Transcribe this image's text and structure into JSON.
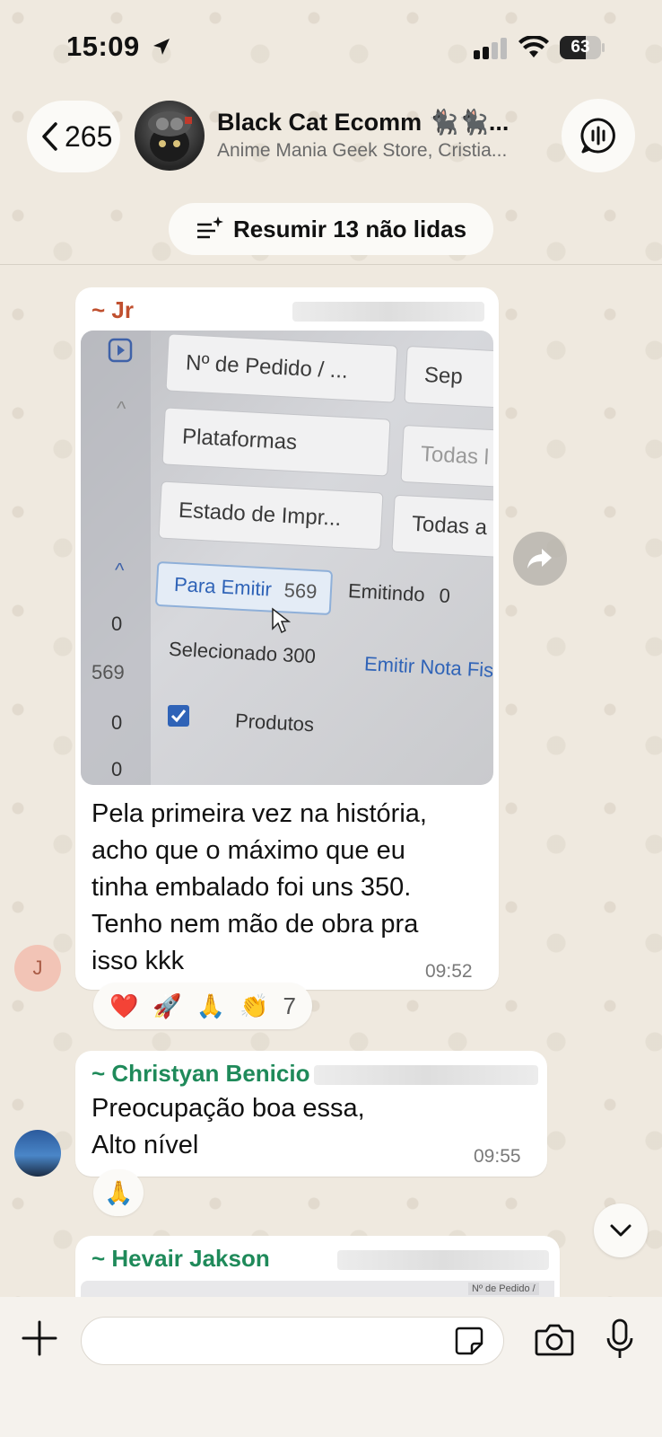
{
  "status_bar": {
    "time": "15:09",
    "battery": "63",
    "battery_level": 0.63
  },
  "header": {
    "back_count": "265",
    "group_title": "Black Cat Ecomm 🐈‍⬛🐈‍⬛...",
    "group_subtitle": "Anime Mania Geek Store, Cristia...",
    "summary_label": "Resumir 13 não lidas"
  },
  "messages": [
    {
      "sender": "~ Jr",
      "sender_color": "#c0502f",
      "image": {
        "field_order": "Nº de Pedido / ...",
        "field_sep": "Sep",
        "field_platforms": "Plataformas",
        "field_all1": "Todas l",
        "field_print_state": "Estado de Impr...",
        "field_all2": "Todas a",
        "tab_to_issue": "Para Emitir",
        "tab_to_issue_count": "569",
        "tab_issuing": "Emitindo",
        "tab_issuing_count": "0",
        "selected": "Selecionado 300",
        "emit_nf": "Emitir Nota Fis",
        "products": "Produtos",
        "side_counts": [
          "0",
          "569",
          "0",
          "0"
        ]
      },
      "text_lines": [
        "Pela primeira vez na história,",
        "acho que o máximo que eu",
        "tinha embalado foi uns 350.",
        "Tenho nem mão de obra pra",
        "isso kkk"
      ],
      "time": "09:52",
      "avatar_initial": "J",
      "reactions": [
        "❤️",
        "🚀",
        "🙏",
        "👏"
      ],
      "reaction_count": "7"
    },
    {
      "sender": "~ Christyan Benicio",
      "sender_color": "#1f8a5a",
      "text_lines": [
        "Preocupação boa essa,",
        "Alto nível"
      ],
      "time": "09:55",
      "reactions": [
        "🙏"
      ]
    },
    {
      "sender": "~ Hevair Jakson",
      "sender_color": "#1f8a5a",
      "preview_text": "Nº de Pedido /"
    }
  ],
  "input": {
    "placeholder": ""
  },
  "colors": {
    "chat_bg": "#efe9df",
    "bubble": "#ffffff",
    "link_blue": "#2f63b7"
  }
}
